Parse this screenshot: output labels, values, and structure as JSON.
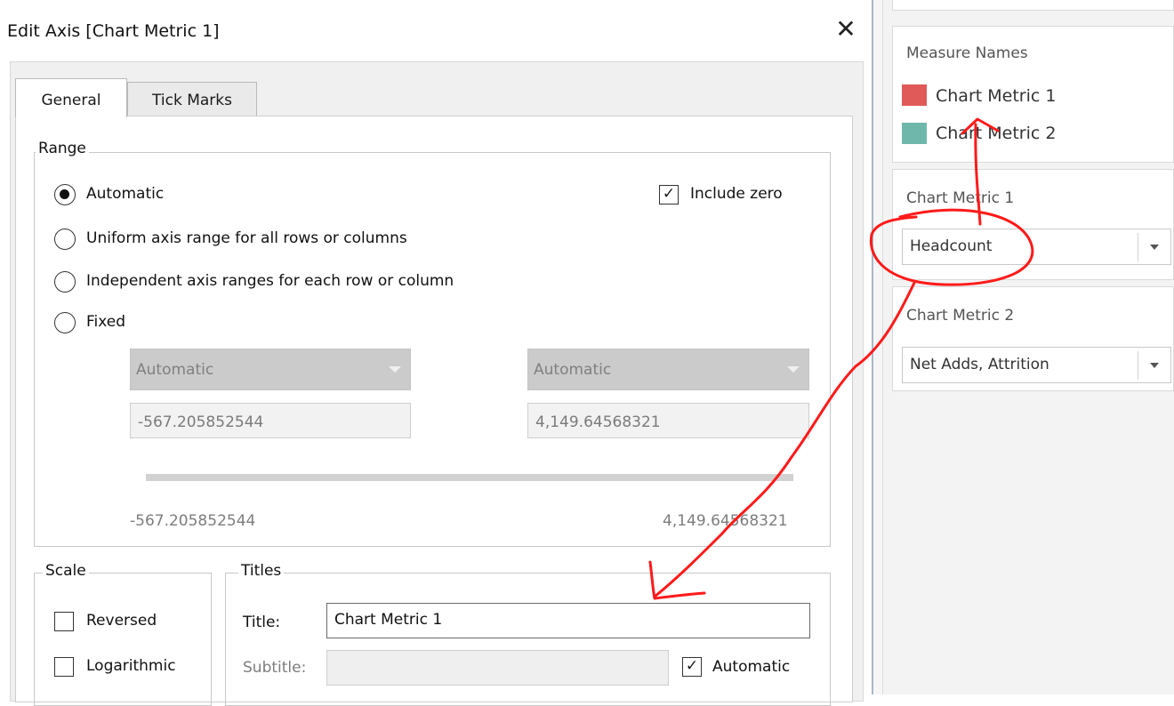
{
  "dialog": {
    "title": "Edit Axis [Chart Metric 1]",
    "close_glyph": "✕",
    "tabs": [
      {
        "label": "General",
        "selected": true
      },
      {
        "label": "Tick Marks",
        "selected": false
      }
    ],
    "range": {
      "legend": "Range",
      "options": [
        {
          "label": "Automatic",
          "checked": true
        },
        {
          "label": "Uniform axis range for all rows or columns",
          "checked": false
        },
        {
          "label": "Independent axis ranges for each row or column",
          "checked": false
        },
        {
          "label": "Fixed",
          "checked": false
        }
      ],
      "include_zero": {
        "label": "Include zero",
        "checked": true
      },
      "start_dropdown": "Automatic",
      "end_dropdown": "Automatic",
      "start_value": "-567.205852544",
      "end_value": "4,149.64568321",
      "slider_min": "-567.205852544",
      "slider_max": "4,149.64568321"
    },
    "scale": {
      "legend": "Scale",
      "reversed": {
        "label": "Reversed",
        "checked": false
      },
      "logarithmic": {
        "label": "Logarithmic",
        "checked": false
      }
    },
    "titles": {
      "legend": "Titles",
      "title_label": "Title:",
      "title_value": "Chart Metric 1",
      "subtitle_label": "Subtitle:",
      "subtitle_value": "",
      "automatic": {
        "label": "Automatic",
        "checked": true
      }
    }
  },
  "right_panel": {
    "legend_card": {
      "title": "Measure Names",
      "items": [
        {
          "label": "Chart Metric 1",
          "color": "#e05a5a"
        },
        {
          "label": "Chart Metric 2",
          "color": "#6fb7ab"
        }
      ]
    },
    "param1": {
      "title": "Chart Metric 1",
      "value": "Headcount"
    },
    "param2": {
      "title": "Chart Metric 2",
      "value": "Net Adds, Attrition"
    }
  },
  "colors": {
    "annotation_red": "#ff1a1a"
  }
}
